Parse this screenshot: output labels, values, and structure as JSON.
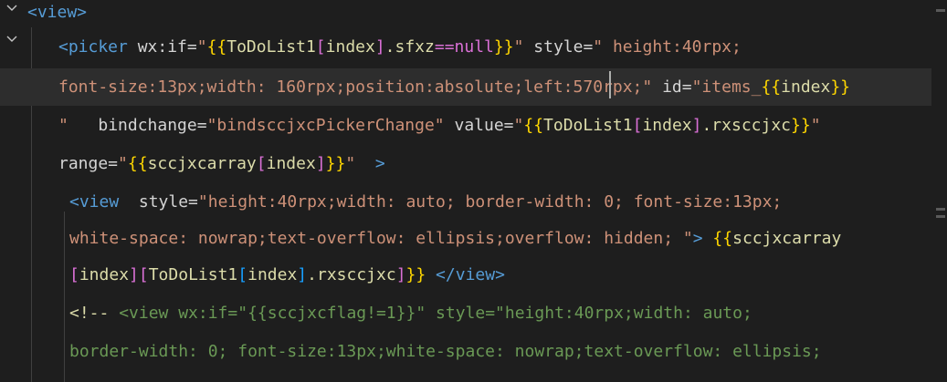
{
  "editor": {
    "lines": [
      {
        "indent": 30,
        "tokens": [
          {
            "t": "<view>",
            "c": "t-tag"
          }
        ]
      },
      {
        "indent": 64,
        "tokens": [
          {
            "t": "<picker",
            "c": "t-tag"
          },
          {
            "t": " wx:if=",
            "c": "t-attr"
          },
          {
            "t": "\"",
            "c": "t-str"
          },
          {
            "t": "{{",
            "c": "t-b1"
          },
          {
            "t": "ToDoList1",
            "c": "t-yel"
          },
          {
            "t": "[",
            "c": "t-b2"
          },
          {
            "t": "index",
            "c": "t-yel"
          },
          {
            "t": "]",
            "c": "t-b2"
          },
          {
            "t": ".sfxz",
            "c": "t-yel"
          },
          {
            "t": "==",
            "c": "t-b2"
          },
          {
            "t": "null",
            "c": "t-null"
          },
          {
            "t": "}}",
            "c": "t-b1"
          },
          {
            "t": "\"",
            "c": "t-str"
          },
          {
            "t": " style=",
            "c": "t-attr"
          },
          {
            "t": "\" height:40rpx;",
            "c": "t-str"
          }
        ]
      },
      {
        "indent": 64,
        "tokens": [
          {
            "t": "font-size:13px;width: 160rpx;position:absolute;left:570rpx;",
            "c": "t-str"
          },
          {
            "t": "\"",
            "c": "t-str"
          },
          {
            "t": " id=",
            "c": "t-attr"
          },
          {
            "t": "\"items_",
            "c": "t-str"
          },
          {
            "t": "{{",
            "c": "t-b1"
          },
          {
            "t": "index",
            "c": "t-yel"
          },
          {
            "t": "}}",
            "c": "t-b1"
          }
        ]
      },
      {
        "indent": 64,
        "tokens": [
          {
            "t": "\"",
            "c": "t-str"
          },
          {
            "t": "   bindchange=",
            "c": "t-attr"
          },
          {
            "t": "\"bindsccjxcPickerChange\"",
            "c": "t-str"
          },
          {
            "t": " value=",
            "c": "t-attr"
          },
          {
            "t": "\"",
            "c": "t-str"
          },
          {
            "t": "{{",
            "c": "t-b1"
          },
          {
            "t": "ToDoList1",
            "c": "t-yel"
          },
          {
            "t": "[",
            "c": "t-b2"
          },
          {
            "t": "index",
            "c": "t-yel"
          },
          {
            "t": "]",
            "c": "t-b2"
          },
          {
            "t": ".rxsccjxc",
            "c": "t-yel"
          },
          {
            "t": "}}",
            "c": "t-b1"
          },
          {
            "t": "\"",
            "c": "t-str"
          }
        ]
      },
      {
        "indent": 64,
        "tokens": [
          {
            "t": "range=",
            "c": "t-attr"
          },
          {
            "t": "\"",
            "c": "t-str"
          },
          {
            "t": "{{",
            "c": "t-b1"
          },
          {
            "t": "sccjxcarray",
            "c": "t-yel"
          },
          {
            "t": "[",
            "c": "t-b2"
          },
          {
            "t": "index",
            "c": "t-yel"
          },
          {
            "t": "]",
            "c": "t-b2"
          },
          {
            "t": "}}",
            "c": "t-b1"
          },
          {
            "t": "\"",
            "c": "t-str"
          },
          {
            "t": "  >",
            "c": "t-tag"
          }
        ]
      },
      {
        "indent": 76,
        "tokens": [
          {
            "t": "<view",
            "c": "t-tag"
          },
          {
            "t": "  style=",
            "c": "t-attr"
          },
          {
            "t": "\"height:40rpx;width: auto; border-width: 0; font-size:13px;",
            "c": "t-str"
          }
        ]
      },
      {
        "indent": 76,
        "tokens": [
          {
            "t": "white-space: nowrap;text-overflow: ellipsis;overflow: hidden; \"",
            "c": "t-str"
          },
          {
            "t": "> ",
            "c": "t-tag"
          },
          {
            "t": "{{",
            "c": "t-b1"
          },
          {
            "t": "sccjxcarray",
            "c": "t-yel"
          }
        ]
      },
      {
        "indent": 76,
        "tokens": [
          {
            "t": "[",
            "c": "t-b2"
          },
          {
            "t": "index",
            "c": "t-yel"
          },
          {
            "t": "]",
            "c": "t-b2"
          },
          {
            "t": "[",
            "c": "t-b2"
          },
          {
            "t": "ToDoList1",
            "c": "t-yel"
          },
          {
            "t": "[",
            "c": "t-b3"
          },
          {
            "t": "index",
            "c": "t-yel"
          },
          {
            "t": "]",
            "c": "t-b3"
          },
          {
            "t": ".rxsccjxc",
            "c": "t-yel"
          },
          {
            "t": "]",
            "c": "t-b2"
          },
          {
            "t": "}}",
            "c": "t-b1"
          },
          {
            "t": " </view>",
            "c": "t-tag"
          }
        ]
      },
      {
        "indent": 76,
        "tokens": [
          {
            "t": "<!-- ",
            "c": "t-yel"
          },
          {
            "t": "<view",
            "c": "t-green"
          },
          {
            "t": " wx:if=",
            "c": "t-green"
          },
          {
            "t": "\"",
            "c": "t-green"
          },
          {
            "t": "{{",
            "c": "t-green"
          },
          {
            "t": "sccjxcflag!=1",
            "c": "t-green"
          },
          {
            "t": "}}",
            "c": "t-green"
          },
          {
            "t": "\"",
            "c": "t-green"
          },
          {
            "t": " style=",
            "c": "t-green"
          },
          {
            "t": "\"height:40rpx;width: auto;",
            "c": "t-green"
          }
        ]
      },
      {
        "indent": 76,
        "tokens": [
          {
            "t": "border-width: 0; font-size:13px;white-space: nowrap;text-overflow: ellipsis;",
            "c": "t-green"
          }
        ]
      }
    ]
  }
}
